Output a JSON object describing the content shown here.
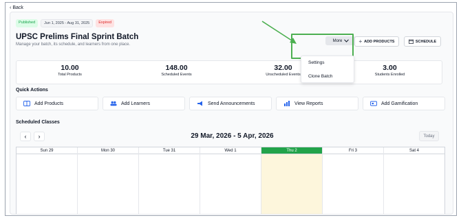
{
  "back": {
    "label": "Back"
  },
  "badges": {
    "status": "Published",
    "dates": "Jun 1, 2025 - Aug 31, 2025",
    "expiry": "Expired"
  },
  "batch": {
    "title": "UPSC Prelims Final Sprint Batch",
    "subtitle": "Manage your batch, its schedule, and learners from one place."
  },
  "toolbar": {
    "more_label": "More",
    "add_products_label": "ADD PRODUCTS",
    "schedule_label": "SCHEDULE"
  },
  "more_menu": {
    "items": [
      "Settings",
      "Clone Batch"
    ]
  },
  "stats": [
    {
      "value": "10.00",
      "label": "Total Products"
    },
    {
      "value": "148.00",
      "label": "Scheduled Events"
    },
    {
      "value": "32.00",
      "label": "Unscheduled Events"
    },
    {
      "value": "3.00",
      "label": "Students Enrolled"
    }
  ],
  "quick_actions": {
    "title": "Quick Actions",
    "items": [
      {
        "label": "Add Products",
        "icon": "book-icon"
      },
      {
        "label": "Add Learners",
        "icon": "users-icon"
      },
      {
        "label": "Send Announcements",
        "icon": "megaphone-icon"
      },
      {
        "label": "View Reports",
        "icon": "bar-chart-icon"
      },
      {
        "label": "Add Gamification",
        "icon": "ticket-icon"
      }
    ]
  },
  "schedule": {
    "title": "Scheduled Classes",
    "range": "29 Mar, 2026 - 5 Apr, 2026",
    "today_label": "Today",
    "days": [
      "Sun 29",
      "Mon 30",
      "Tue 31",
      "Wed 1",
      "Thu 2",
      "Fri 3",
      "Sat 4"
    ],
    "today_index": 4
  },
  "colors": {
    "accent_green": "#22a34a",
    "highlight": "#4caf50",
    "today_fill": "#fdf6dc"
  }
}
